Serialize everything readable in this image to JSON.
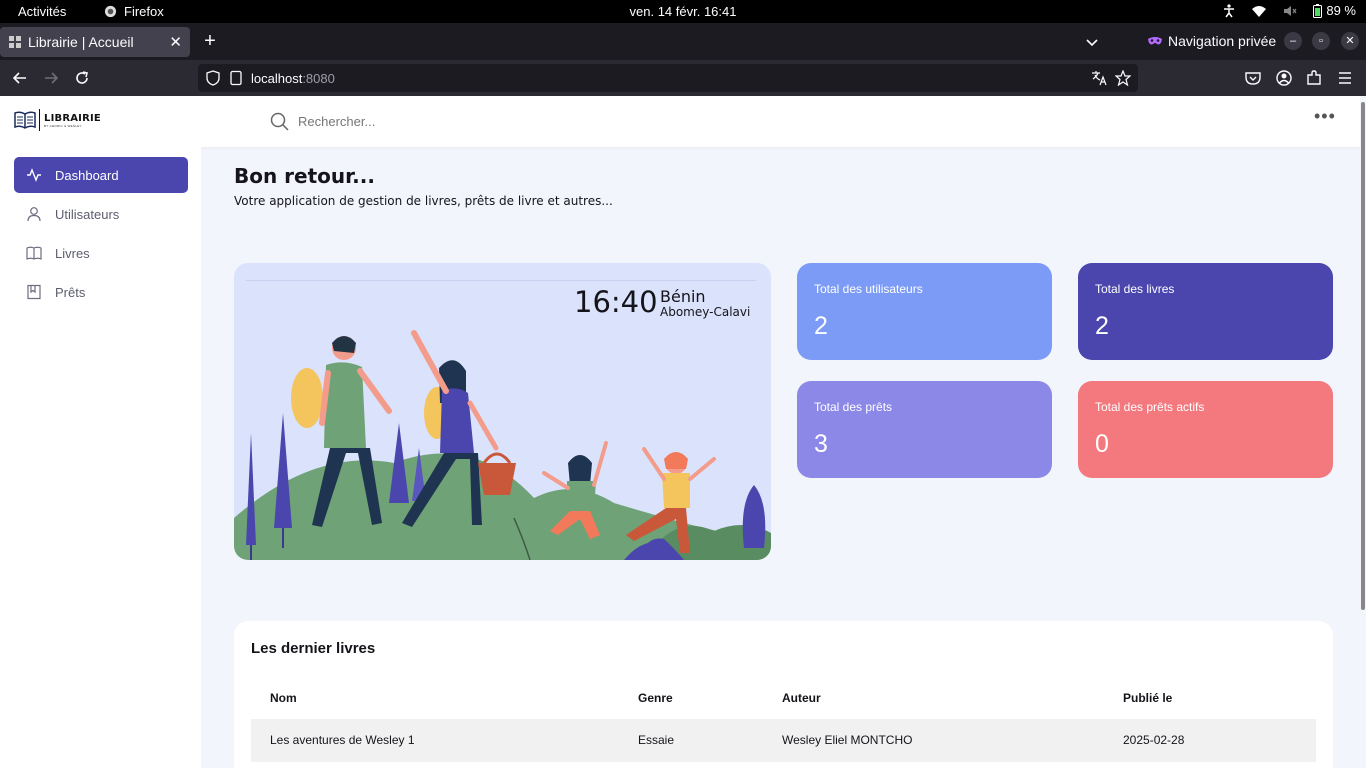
{
  "os": {
    "activities": "Activités",
    "app_name": "Firefox",
    "clock": "ven. 14 févr.  16:41",
    "battery": "89 %"
  },
  "browser": {
    "tab_title": "Librairie | Accueil",
    "private_label": "Navigation privée",
    "url_host": "localhost",
    "url_port": ":8080"
  },
  "app": {
    "logo_name": "LIBRAIRIE",
    "logo_tagline": "BY CEDRIC & WESLEY",
    "search_placeholder": "Rechercher..."
  },
  "sidebar": {
    "items": [
      {
        "label": "Dashboard",
        "icon": "activity-icon",
        "active": true
      },
      {
        "label": "Utilisateurs",
        "icon": "user-icon",
        "active": false
      },
      {
        "label": "Livres",
        "icon": "book-icon",
        "active": false
      },
      {
        "label": "Prêts",
        "icon": "bookmark-icon",
        "active": false
      }
    ]
  },
  "welcome": {
    "title": "Bon retour...",
    "subtitle": "Votre application de gestion de livres, prêts de livre et autres..."
  },
  "hero": {
    "time": "16:40",
    "country": "Bénin",
    "city": "Abomey-Calavi"
  },
  "stats": [
    {
      "label": "Total des utilisateurs",
      "value": "2",
      "color": "#7b9bf6"
    },
    {
      "label": "Total des livres",
      "value": "2",
      "color": "#4a46ae"
    },
    {
      "label": "Total des prêts",
      "value": "3",
      "color": "#8c88e8"
    },
    {
      "label": "Total des prêts actifs",
      "value": "0",
      "color": "#f3797e"
    }
  ],
  "books": {
    "title": "Les dernier livres",
    "columns": [
      "Nom",
      "Genre",
      "Auteur",
      "Publié le"
    ],
    "rows": [
      [
        "Les aventures de Wesley 1",
        "Essaie",
        "Wesley Eliel MONTCHO",
        "2025-02-28"
      ]
    ]
  },
  "colors": {
    "accent": "#4a46ae",
    "page_bg": "#f3f5fc",
    "hero_bg": "#dbe2fb"
  }
}
